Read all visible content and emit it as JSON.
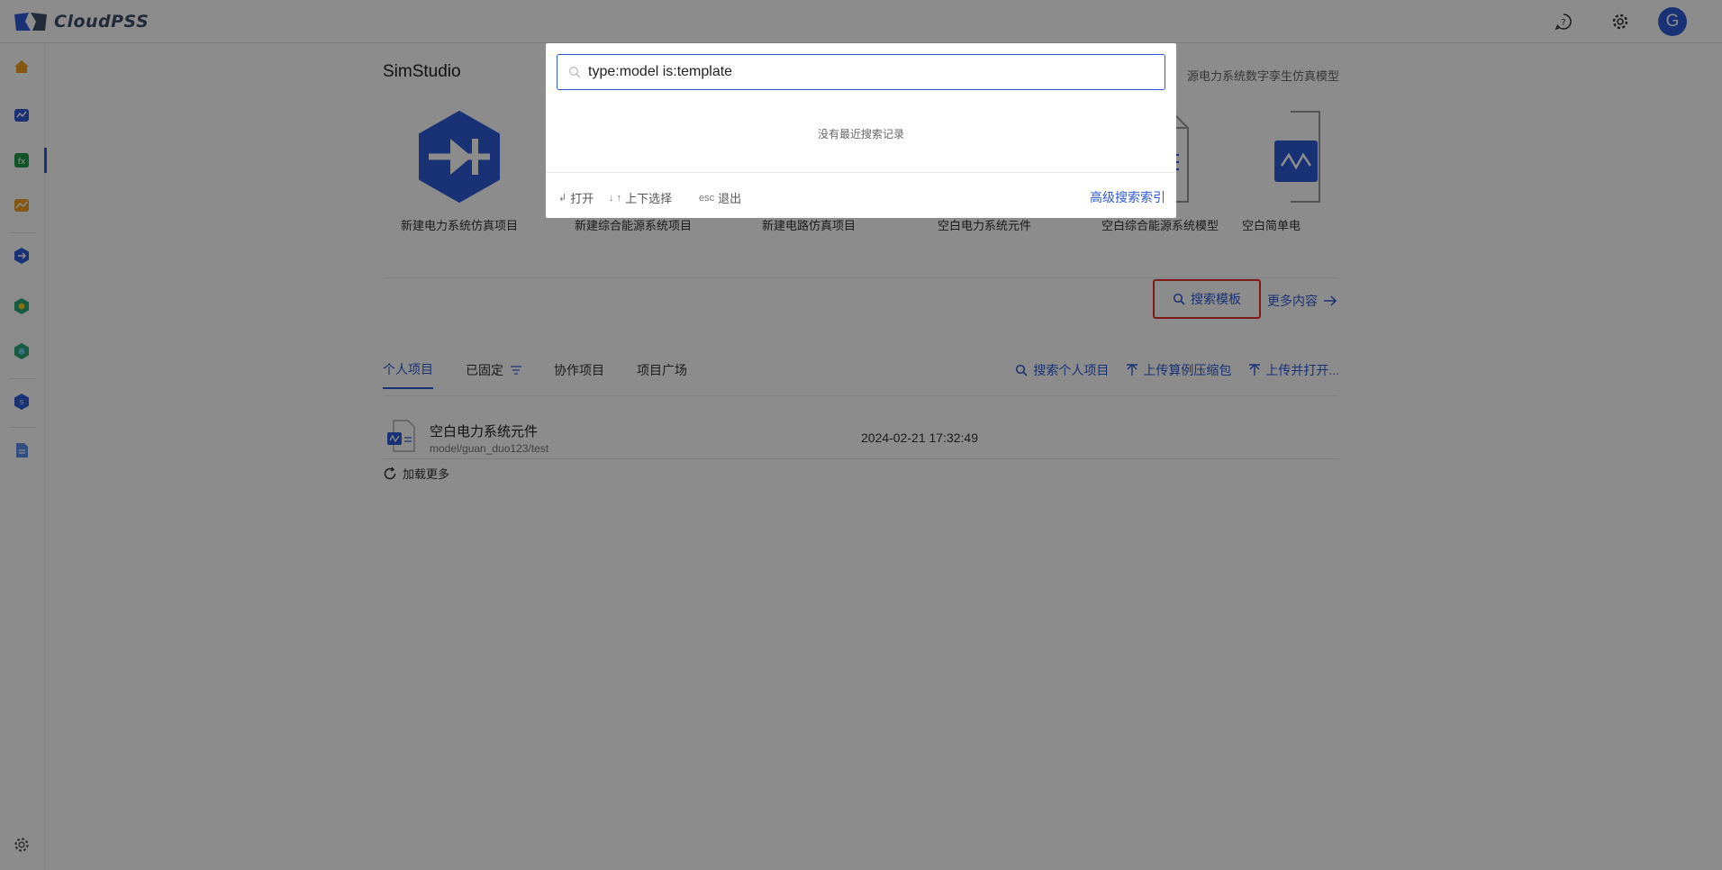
{
  "app": {
    "brand": "CloudPSS",
    "avatar_letter": "G"
  },
  "topbar": {
    "icons": [
      "help-icon",
      "settings-icon"
    ]
  },
  "sidebar": {
    "items": [
      "home-icon",
      "simstudio-icon",
      "function-icon",
      "chart-icon",
      "emt-icon",
      "ies-icon",
      "ies-lab-icon",
      "sim-icon",
      "doc-icon"
    ],
    "bottom_icon": "settings-icon"
  },
  "simstudio": {
    "title": "SimStudio",
    "subtitle": "源电力系统数字孪生仿真模型",
    "templates": [
      {
        "label": "新建电力系统仿真项目",
        "icon": "emt-hex-icon"
      },
      {
        "label": "新建综合能源系统项目",
        "icon": "ies-hex-icon"
      },
      {
        "label": "新建电路仿真项目",
        "icon": "circuit-icon"
      },
      {
        "label": "空白电力系统元件",
        "icon": "component-icon"
      },
      {
        "label": "空白综合能源系统模型",
        "icon": "doc-outline-icon"
      },
      {
        "label": "空白简单电",
        "icon": "wave-doc-icon"
      }
    ],
    "search_templates": "搜索模板",
    "more_content": "更多内容"
  },
  "projects": {
    "tabs": [
      {
        "label": "个人项目",
        "active": true
      },
      {
        "label": "已固定",
        "active": false
      },
      {
        "label": "协作项目",
        "active": false
      },
      {
        "label": "项目广场",
        "active": false
      }
    ],
    "actions": [
      "搜索个人项目",
      "上传算例压缩包",
      "上传并打开..."
    ],
    "rows": [
      {
        "name": "空白电力系统元件",
        "path": "model/guan_duo123/test",
        "time": "2024-02-21 17:32:49"
      }
    ],
    "load_more": "加载更多"
  },
  "search_modal": {
    "query": "type:model is:template",
    "empty_text": "没有最近搜索记录",
    "hints": [
      {
        "key": "↲",
        "label": "打开"
      },
      {
        "key": "↓ ↑",
        "label": "上下选择"
      },
      {
        "key": "esc",
        "label": "退出"
      }
    ],
    "advanced_link": "高级搜索索引"
  },
  "colors": {
    "accent": "#2f5bd6",
    "highlight_box": "#e5322d",
    "overlay": "rgba(0,0,0,0.45)"
  }
}
